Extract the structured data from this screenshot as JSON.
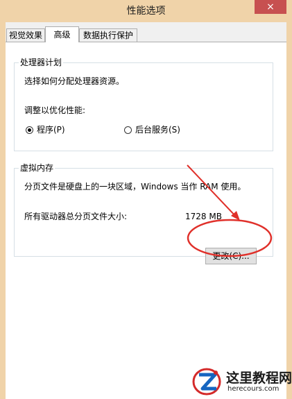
{
  "window": {
    "title": "性能选项",
    "close_glyph": "×"
  },
  "tabs": [
    {
      "label": "视觉效果",
      "active": false
    },
    {
      "label": "高级",
      "active": true
    },
    {
      "label": "数据执行保护",
      "active": false
    }
  ],
  "processor_group": {
    "title": "处理器计划",
    "description": "选择如何分配处理器资源。",
    "adjust_label": "调整以优化性能:",
    "options": [
      {
        "label": "程序(P)",
        "selected": true
      },
      {
        "label": "后台服务(S)",
        "selected": false
      }
    ]
  },
  "virtual_memory_group": {
    "title": "虚拟内存",
    "description": "分页文件是硬盘上的一块区域，Windows 当作 RAM 使用。",
    "total_label": "所有驱动器总分页文件大小:",
    "total_value": "1728 MB",
    "change_button": "更改(C)..."
  },
  "annotation": {
    "color": "#e0302a"
  },
  "watermark": {
    "title": "这里教程网",
    "url": "herecours.com",
    "icon": "z-logo-icon"
  }
}
